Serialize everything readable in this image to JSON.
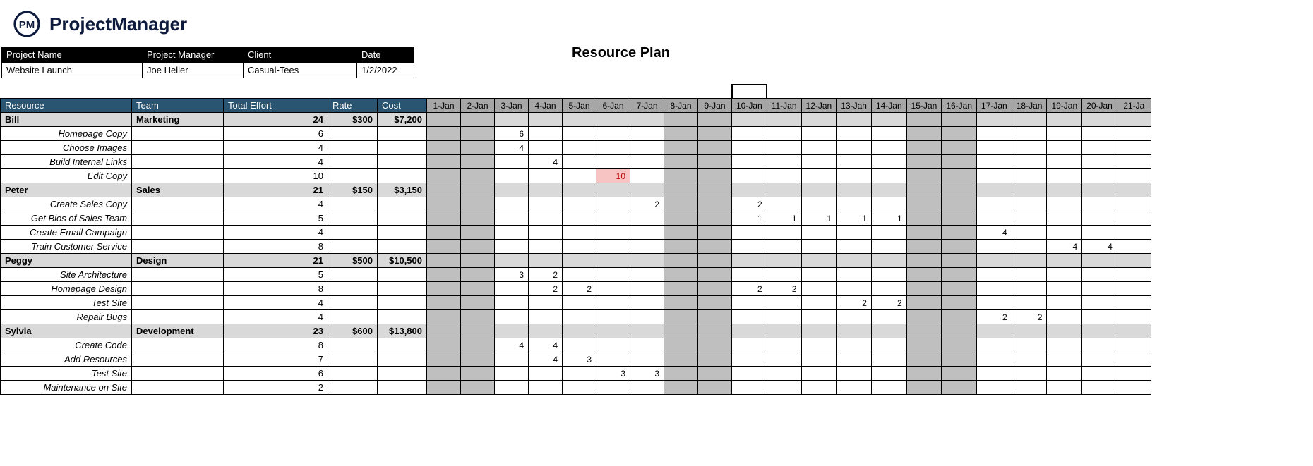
{
  "brand": {
    "name": "ProjectManager",
    "logo_text": "PM"
  },
  "title": "Resource Plan",
  "meta": {
    "headers": {
      "project_name": "Project Name",
      "project_manager": "Project Manager",
      "client": "Client",
      "date": "Date"
    },
    "values": {
      "project_name": "Website Launch",
      "project_manager": "Joe Heller",
      "client": "Casual-Tees",
      "date": "1/2/2022"
    }
  },
  "columns": {
    "resource": "Resource",
    "team": "Team",
    "total_effort": "Total Effort",
    "rate": "Rate",
    "cost": "Cost"
  },
  "dates": [
    "1-Jan",
    "2-Jan",
    "3-Jan",
    "4-Jan",
    "5-Jan",
    "6-Jan",
    "7-Jan",
    "8-Jan",
    "9-Jan",
    "10-Jan",
    "11-Jan",
    "12-Jan",
    "13-Jan",
    "14-Jan",
    "15-Jan",
    "16-Jan",
    "17-Jan",
    "18-Jan",
    "19-Jan",
    "20-Jan",
    "21-Ja"
  ],
  "weekend_indices": [
    0,
    1,
    7,
    8,
    14,
    15
  ],
  "selected_date_index": 9,
  "resources": [
    {
      "name": "Bill",
      "team": "Marketing",
      "effort": 24,
      "rate": "$300",
      "cost": "$7,200",
      "tasks": [
        {
          "name": "Homepage Copy",
          "effort": 6,
          "alloc": {
            "3-Jan": 6
          }
        },
        {
          "name": "Choose Images",
          "effort": 4,
          "alloc": {
            "3-Jan": 4
          }
        },
        {
          "name": "Build Internal Links",
          "effort": 4,
          "alloc": {
            "4-Jan": 4
          }
        },
        {
          "name": "Edit Copy",
          "effort": 10,
          "alloc": {
            "6-Jan": 10
          },
          "over": [
            "6-Jan"
          ]
        }
      ]
    },
    {
      "name": "Peter",
      "team": "Sales",
      "effort": 21,
      "rate": "$150",
      "cost": "$3,150",
      "tasks": [
        {
          "name": "Create Sales Copy",
          "effort": 4,
          "alloc": {
            "7-Jan": 2,
            "10-Jan": 2
          }
        },
        {
          "name": "Get Bios of Sales Team",
          "effort": 5,
          "alloc": {
            "10-Jan": 1,
            "11-Jan": 1,
            "12-Jan": 1,
            "13-Jan": 1,
            "14-Jan": 1
          }
        },
        {
          "name": "Create Email Campaign",
          "effort": 4,
          "alloc": {
            "17-Jan": 4
          }
        },
        {
          "name": "Train Customer Service",
          "effort": 8,
          "alloc": {
            "19-Jan": 4,
            "20-Jan": 4
          }
        }
      ]
    },
    {
      "name": "Peggy",
      "team": "Design",
      "effort": 21,
      "rate": "$500",
      "cost": "$10,500",
      "tasks": [
        {
          "name": "Site Architecture",
          "effort": 5,
          "alloc": {
            "3-Jan": 3,
            "4-Jan": 2
          }
        },
        {
          "name": "Homepage Design",
          "effort": 8,
          "alloc": {
            "4-Jan": 2,
            "5-Jan": 2,
            "10-Jan": 2,
            "11-Jan": 2
          }
        },
        {
          "name": "Test Site",
          "effort": 4,
          "alloc": {
            "13-Jan": 2,
            "14-Jan": 2
          }
        },
        {
          "name": "Repair Bugs",
          "effort": 4,
          "alloc": {
            "17-Jan": 2,
            "18-Jan": 2
          }
        }
      ]
    },
    {
      "name": "Sylvia",
      "team": "Development",
      "effort": 23,
      "rate": "$600",
      "cost": "$13,800",
      "tasks": [
        {
          "name": "Create Code",
          "effort": 8,
          "alloc": {
            "3-Jan": 4,
            "4-Jan": 4
          }
        },
        {
          "name": "Add Resources",
          "effort": 7,
          "alloc": {
            "4-Jan": 4,
            "5-Jan": 3
          }
        },
        {
          "name": "Test Site",
          "effort": 6,
          "alloc": {
            "6-Jan": 3,
            "7-Jan": 3
          }
        },
        {
          "name": "Maintenance on Site",
          "effort": 2,
          "alloc": {}
        }
      ]
    }
  ]
}
